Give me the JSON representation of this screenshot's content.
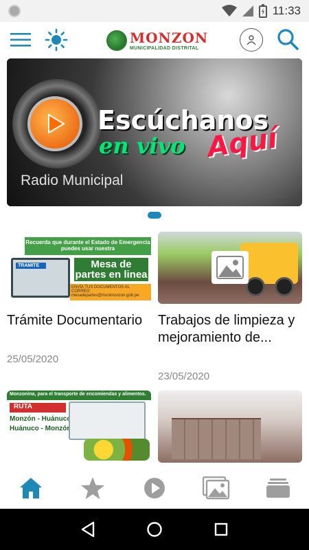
{
  "status_bar": {
    "time": "11:33"
  },
  "header": {
    "logo_title": "MONZON",
    "logo_subtitle": "MUNICIPALIDAD DISTRITAL"
  },
  "banner": {
    "line1": "Escúchanos",
    "line2": "en vivo",
    "line3": "Aquí",
    "caption": "Radio Municipal"
  },
  "cards": [
    {
      "title": "Trámite Documentario",
      "date": "25/05/2020",
      "image_texts": {
        "top": "Recuerda que durante el Estado de Emergencia puedes usar nuestra",
        "laptop": "TRAMITE",
        "box": "Mesa de partes en linea",
        "strip": "ENVÍA TUS DOCUMENTOS AL CORREO: mesadepartes@munimonzon.gob.pe"
      }
    },
    {
      "title": "Trabajos de limpieza y mejoramiento de...",
      "date": "23/05/2020"
    },
    {
      "title": "",
      "date": "",
      "image_texts": {
        "header": "Monzonina, para el transporte de encomiendas y alimentos.",
        "ruta": "RUTA",
        "route1": "Monzón - Huánuco",
        "route2": "Huánuco - Monzón"
      }
    },
    {
      "title": "",
      "date": ""
    }
  ],
  "bottom_nav": [
    "home-icon",
    "star-icon",
    "play-icon",
    "gallery-icon",
    "stack-icon"
  ],
  "colors": {
    "accent": "#1e88b8",
    "nav_inactive": "#9e9e9e"
  }
}
